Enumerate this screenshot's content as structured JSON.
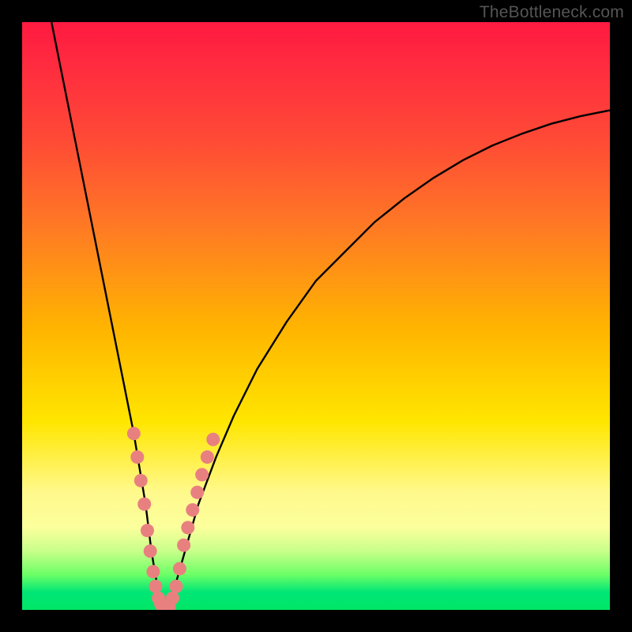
{
  "watermark": "TheBottleneck.com",
  "colors": {
    "page_bg": "#000000",
    "gradient_stops": [
      "#ff1a40",
      "#ff4a36",
      "#ff7a24",
      "#ffb400",
      "#ffe600",
      "#fff98c",
      "#c8ff8a",
      "#00e666"
    ],
    "curve": "#000000",
    "marker": "#e98080",
    "watermark": "#555555"
  },
  "chart_data": {
    "type": "line",
    "title": "",
    "xlabel": "",
    "ylabel": "",
    "xlim": [
      0,
      100
    ],
    "ylim": [
      0,
      100
    ],
    "series": [
      {
        "name": "bottleneck-curve",
        "x": [
          5,
          7,
          9,
          11,
          13,
          15,
          17,
          19,
          20,
          21,
          22,
          23,
          24,
          26,
          28,
          30,
          33,
          36,
          40,
          45,
          50,
          55,
          60,
          65,
          70,
          75,
          80,
          85,
          90,
          95,
          100
        ],
        "y": [
          100,
          90,
          80,
          70,
          60,
          50,
          40,
          30,
          24,
          18,
          10,
          4,
          0,
          4,
          11,
          18,
          26,
          33,
          41,
          49,
          56,
          61,
          66,
          70,
          73.5,
          76.5,
          79,
          81,
          82.7,
          84,
          85
        ]
      }
    ],
    "markers": [
      {
        "x": 19.0,
        "y": 30
      },
      {
        "x": 19.6,
        "y": 26
      },
      {
        "x": 20.2,
        "y": 22
      },
      {
        "x": 20.8,
        "y": 18
      },
      {
        "x": 21.3,
        "y": 13.5
      },
      {
        "x": 21.8,
        "y": 10
      },
      {
        "x": 22.3,
        "y": 6.5
      },
      {
        "x": 22.7,
        "y": 4
      },
      {
        "x": 23.2,
        "y": 2
      },
      {
        "x": 23.6,
        "y": 1
      },
      {
        "x": 24.0,
        "y": 0.3
      },
      {
        "x": 24.5,
        "y": 0.1
      },
      {
        "x": 25.0,
        "y": 0.5
      },
      {
        "x": 25.6,
        "y": 2
      },
      {
        "x": 26.2,
        "y": 4
      },
      {
        "x": 26.8,
        "y": 7
      },
      {
        "x": 27.5,
        "y": 11
      },
      {
        "x": 28.2,
        "y": 14
      },
      {
        "x": 29.0,
        "y": 17
      },
      {
        "x": 29.8,
        "y": 20
      },
      {
        "x": 30.6,
        "y": 23
      },
      {
        "x": 31.5,
        "y": 26
      },
      {
        "x": 32.5,
        "y": 29
      }
    ],
    "optimum_x": 24
  }
}
